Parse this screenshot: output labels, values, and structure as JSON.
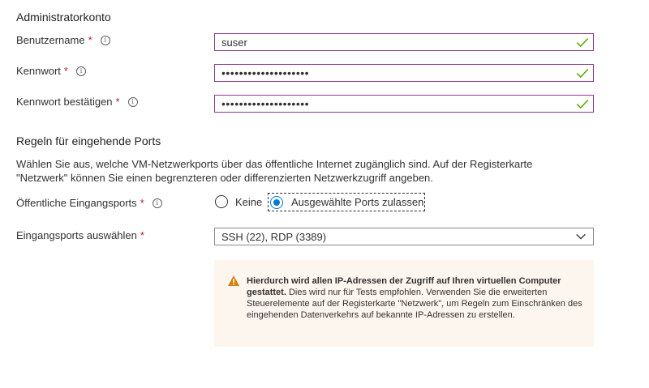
{
  "admin": {
    "section_title": "Administratorkonto",
    "username_label": "Benutzername",
    "username_value": "suser",
    "password_label": "Kennwort",
    "password_value": "••••••••••••••••••••",
    "confirm_label": "Kennwort bestätigen",
    "confirm_value": "••••••••••••••••••••",
    "required_mark": "*",
    "info_glyph": "i"
  },
  "ports": {
    "section_title": "Regeln für eingehende Ports",
    "description": "Wählen Sie aus, welche VM-Netzwerkports über das öffentliche Internet zugänglich sind. Auf der Registerkarte \"Netzwerk\" können Sie einen begrenzteren oder differenzierten Netzwerkzugriff angeben.",
    "public_ports_label": "Öffentliche Eingangsports",
    "option_none": "Keine",
    "option_selected": "Ausgewählte Ports zulassen",
    "select_label": "Eingangsports auswählen",
    "select_value": "SSH (22), RDP (3389)"
  },
  "warning": {
    "bold_text": "Hierdurch wird allen IP-Adressen der Zugriff auf Ihren virtuellen Computer gestattet.",
    "body_text": " Dies wird nur für Tests empfohlen.  Verwenden Sie die erweiterten Steuerelemente auf der Registerkarte \"Netzwerk\", um Regeln zum Einschränken des eingehenden Datenverkehrs auf bekannte IP-Adressen zu erstellen.",
    "icon": "warning-triangle-icon"
  },
  "colors": {
    "valid_border": "#8a3a8f",
    "check_green": "#57a300",
    "accent": "#0078d4",
    "warning_bg": "#fdf6ef",
    "warning_icon": "#d87f0a"
  }
}
